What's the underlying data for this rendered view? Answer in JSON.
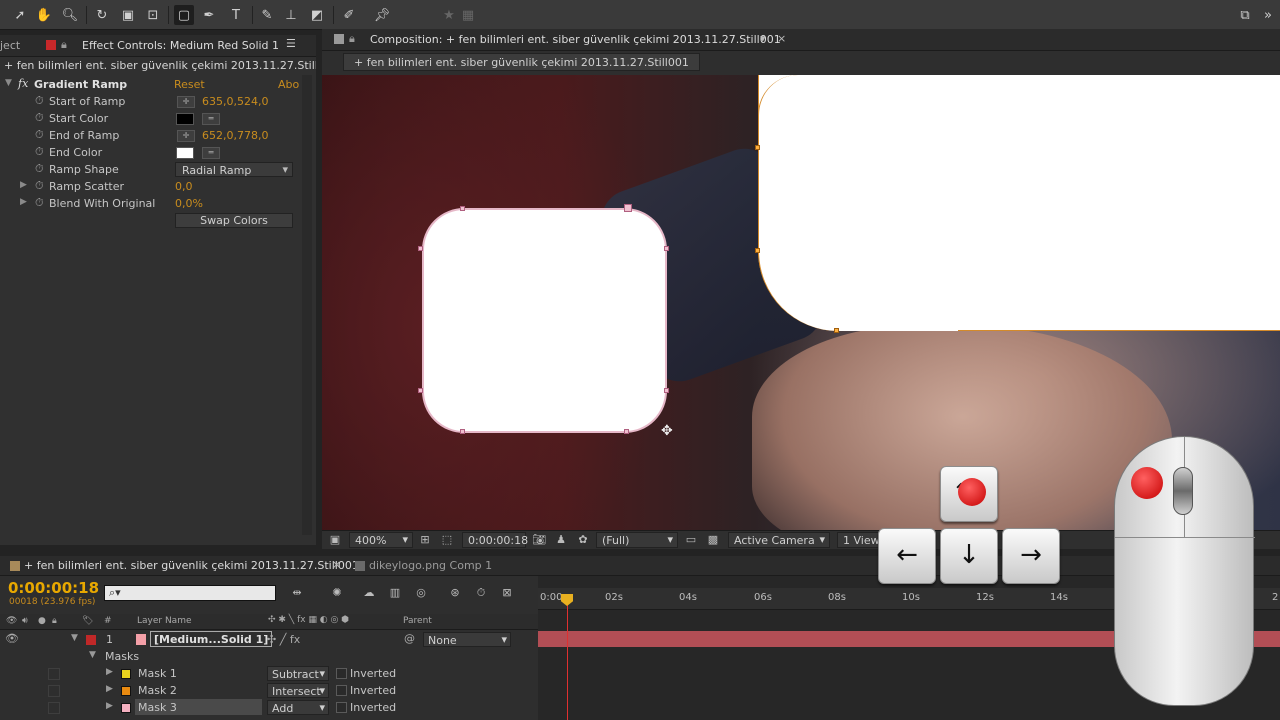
{
  "toolbar": {
    "icons": [
      "selection-tool",
      "hand-tool",
      "zoom-tool",
      "rotation-tool",
      "camera-tool",
      "pan-behind-tool",
      "rectangle-mask-tool",
      "pen-tool",
      "type-tool",
      "brush-tool",
      "clone-stamp-tool",
      "eraser-tool",
      "roto-brush-tool",
      "puppet-pin-tool"
    ]
  },
  "left_panel": {
    "tab_project": "ject",
    "tab_effect": "Effect Controls: Medium Red Solid 1",
    "subtitle": "+ fen bilimleri ent. siber güvenlik çekimi 2013.11.27.Still001 •",
    "effect_name": "Gradient Ramp",
    "reset": "Reset",
    "about": "Abo",
    "props": [
      {
        "label": "Start of Ramp",
        "value": "635,0,524,0"
      },
      {
        "label": "Start Color",
        "value": ""
      },
      {
        "label": "End of Ramp",
        "value": "652,0,778,0"
      },
      {
        "label": "End Color",
        "value": ""
      },
      {
        "label": "Ramp Shape",
        "value": "Radial Ramp"
      },
      {
        "label": "Ramp Scatter",
        "value": "0,0"
      },
      {
        "label": "Blend With Original",
        "value": "0,0%"
      }
    ],
    "swap_colors": "Swap Colors",
    "colors": {
      "start": "#000000",
      "end": "#ffffff"
    }
  },
  "comp_panel": {
    "tab_title": "Composition: + fen bilimleri ent. siber güvenlik çekimi 2013.11.27.Still001",
    "flow_tab": "+ fen bilimleri ent. siber güvenlik çekimi 2013.11.27.Still001",
    "footer": {
      "zoom": "400%",
      "timecode": "0:00:00:18",
      "resolution": "(Full)",
      "camera": "Active Camera",
      "views": "1 View"
    }
  },
  "timeline": {
    "tab_main": "+ fen bilimleri ent. siber güvenlik çekimi 2013.11.27.Still001",
    "tab_second": "dikeylogo.png Comp 1",
    "timecode": "0:00:00:18",
    "frames": "00018 (23.976 fps)",
    "search_placeholder": "",
    "header": {
      "number": "#",
      "layer_name": "Layer Name",
      "parent": "Parent"
    },
    "ruler": [
      "0:00s",
      "02s",
      "04s",
      "06s",
      "08s",
      "10s",
      "12s",
      "14s",
      "2"
    ],
    "layer": {
      "index": "1",
      "name": "[Medium...Solid 1]",
      "parent": "None",
      "color": "#f4a0a8"
    },
    "masks_label": "Masks",
    "masks": [
      {
        "name": "Mask 1",
        "mode": "Subtract",
        "inverted": "Inverted",
        "color": "#e8d21e"
      },
      {
        "name": "Mask 2",
        "mode": "Intersect",
        "inverted": "Inverted",
        "color": "#e88a10"
      },
      {
        "name": "Mask 3",
        "mode": "Add",
        "inverted": "Inverted",
        "color": "#f4b0c0"
      }
    ]
  },
  "overlay": {
    "keys": [
      "up-arrow-key",
      "left-arrow-key",
      "down-arrow-key",
      "right-arrow-key"
    ],
    "key_glyphs": {
      "left": "←",
      "down": "↓",
      "right": "→",
      "up": "↑"
    }
  }
}
